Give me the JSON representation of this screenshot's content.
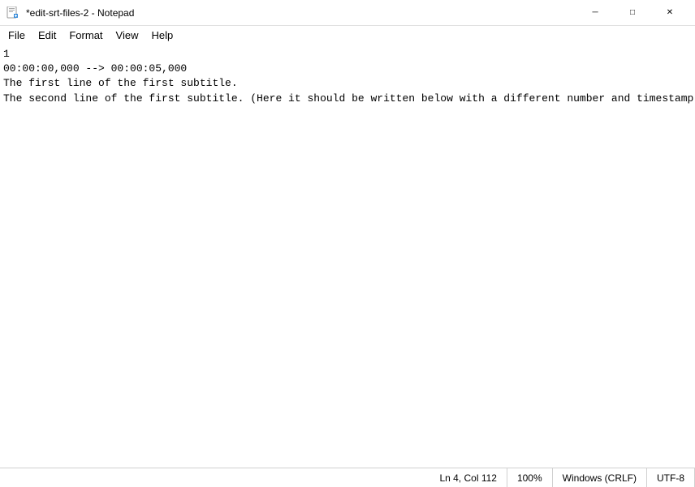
{
  "titleBar": {
    "title": "*edit-srt-files-2 - Notepad",
    "minimizeLabel": "─",
    "maximizeLabel": "□",
    "closeLabel": "✕"
  },
  "menuBar": {
    "items": [
      {
        "id": "file",
        "label": "File"
      },
      {
        "id": "edit",
        "label": "Edit"
      },
      {
        "id": "format",
        "label": "Format"
      },
      {
        "id": "view",
        "label": "View"
      },
      {
        "id": "help",
        "label": "Help"
      }
    ]
  },
  "editor": {
    "content": "1\r\n00:00:00,000 --> 00:00:05,000\r\nThe first line of the first subtitle.\r\nThe second line of the first subtitle. (Here it should be written below with a different number and timestamp)."
  },
  "statusBar": {
    "position": "Ln 4, Col 112",
    "zoom": "100%",
    "lineEnding": "Windows (CRLF)",
    "encoding": "UTF-8"
  }
}
